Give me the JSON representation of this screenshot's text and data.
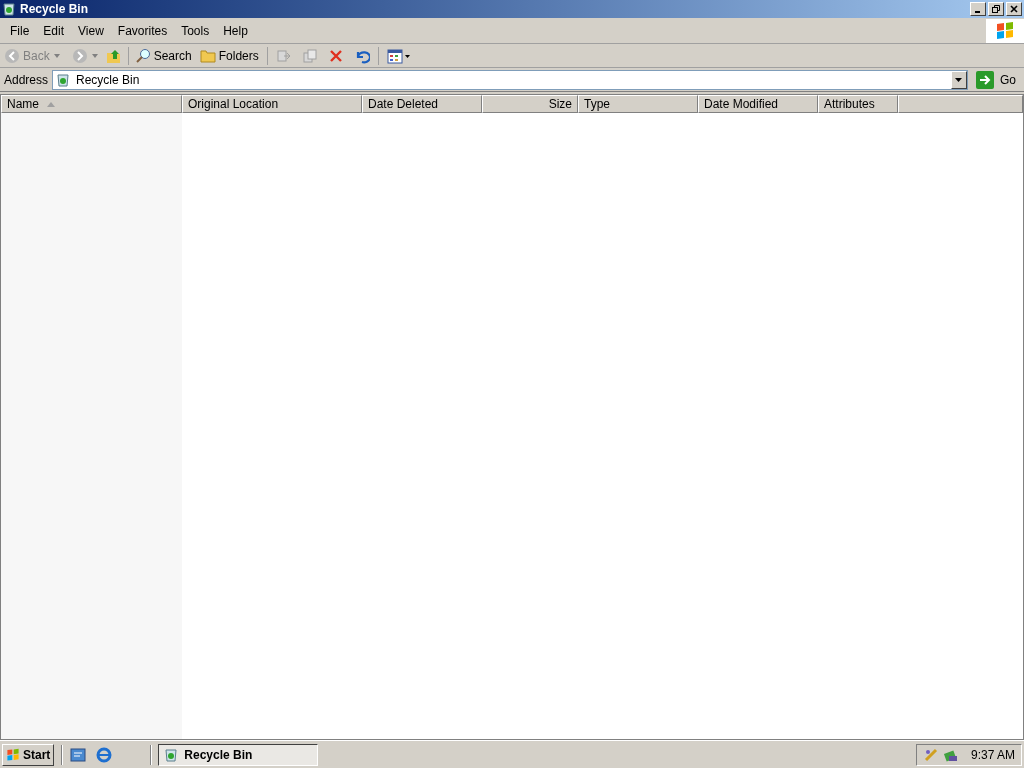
{
  "window": {
    "title": "Recycle Bin"
  },
  "menu": [
    "File",
    "Edit",
    "View",
    "Favorites",
    "Tools",
    "Help"
  ],
  "toolbar": {
    "back": "Back",
    "search": "Search",
    "folders": "Folders"
  },
  "address": {
    "label": "Address",
    "value": "Recycle Bin",
    "go": "Go"
  },
  "columns": [
    {
      "label": "Name",
      "sorted": true,
      "kind": "text"
    },
    {
      "label": "Original Location",
      "sorted": false,
      "kind": "text"
    },
    {
      "label": "Date Deleted",
      "sorted": false,
      "kind": "text"
    },
    {
      "label": "Size",
      "sorted": false,
      "kind": "number"
    },
    {
      "label": "Type",
      "sorted": false,
      "kind": "text"
    },
    {
      "label": "Date Modified",
      "sorted": false,
      "kind": "text"
    },
    {
      "label": "Attributes",
      "sorted": false,
      "kind": "text"
    }
  ],
  "taskbar": {
    "start": "Start",
    "tasks": [
      {
        "label": "Recycle Bin",
        "selected": true
      }
    ],
    "clock": "9:37 AM"
  }
}
